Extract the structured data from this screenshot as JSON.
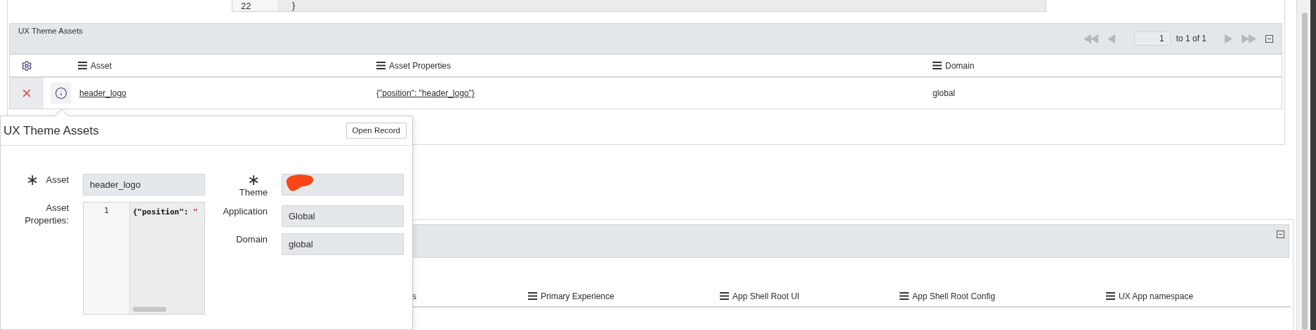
{
  "code_editor": {
    "lines": [
      {
        "number": "22",
        "code": "}"
      }
    ]
  },
  "related_list": {
    "title": "UX Theme Assets",
    "pagination": {
      "page": "1",
      "range": "to 1 of 1"
    },
    "columns": [
      "Asset",
      "Asset Properties",
      "Domain"
    ],
    "rows": [
      {
        "asset": "header_logo",
        "asset_properties": "{\"position\": \"header_logo\"}",
        "domain": "global"
      }
    ]
  },
  "popup": {
    "title": "UX Theme Assets",
    "button": "Open Record",
    "left_fields": [
      {
        "kind": "text",
        "label": "Asset",
        "required_mark": "∗",
        "value": "header_logo"
      },
      {
        "kind": "code",
        "label": "Asset Properties:",
        "line_number": "1",
        "code": [
          {
            "kind": "key",
            "text": "{\"position\": "
          },
          {
            "kind": "string",
            "text": "\""
          }
        ]
      }
    ],
    "right_fields": [
      {
        "kind": "redacted",
        "label": "Theme",
        "required_mark": "∗"
      },
      {
        "kind": "text",
        "label": "Application",
        "value": "Global"
      },
      {
        "kind": "text",
        "label": "Domain",
        "value": "global"
      }
    ]
  },
  "second_list": {
    "columns": [
      "s",
      "Primary Experience",
      "App Shell Root UI",
      "App Shell Root Config",
      "UX App namespace"
    ]
  }
}
